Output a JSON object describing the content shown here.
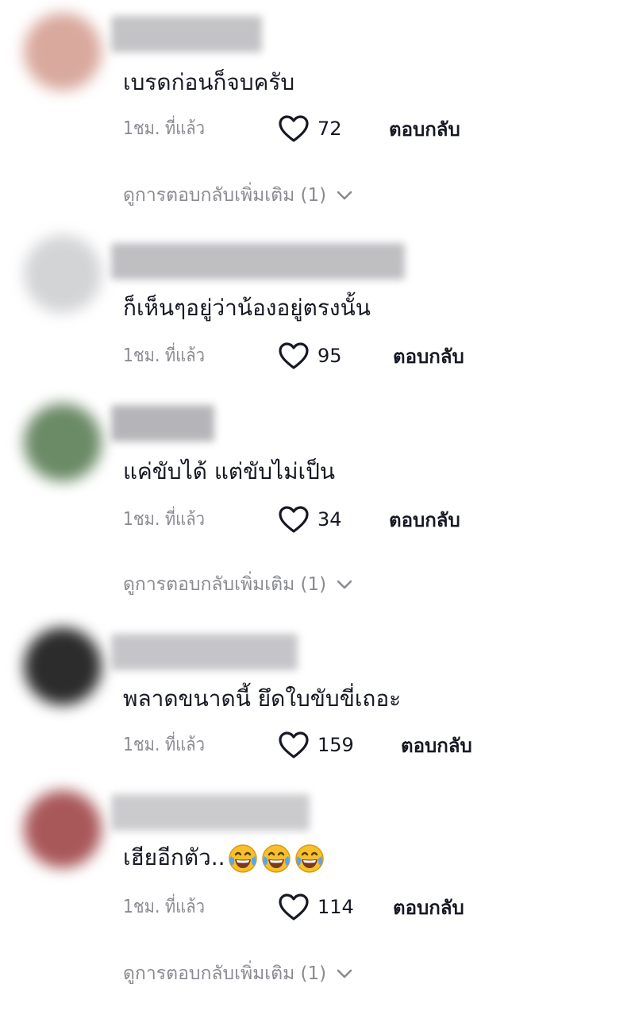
{
  "comments": [
    {
      "text": "เบรดก่อนก็จบครับ",
      "time": "1ชม. ที่แล้ว",
      "likes": "72",
      "reply_label": "ตอบกลับ",
      "view_replies": "ดูการตอบกลับเพิ่มเติม (1)",
      "avatar_color": "#d9a99d",
      "name_blur_color": "#b9b9bd"
    },
    {
      "text": "ก็เห็นๆอยู่ว่าน้องอยู่ตรงนั้น",
      "time": "1ชม. ที่แล้ว",
      "likes": "95",
      "reply_label": "ตอบกลับ",
      "avatar_color": "#d3d4d6",
      "name_blur_color": "#b4b4b8"
    },
    {
      "text": "แค่ขับได้ แต่ขับไม่เป็น",
      "time": "1ชม. ที่แล้ว",
      "likes": "34",
      "reply_label": "ตอบกลับ",
      "view_replies": "ดูการตอบกลับเพิ่มเติม (1)",
      "avatar_color": "#6b8a66",
      "name_blur_color": "#a9a9ad"
    },
    {
      "text": "พลาดขนาดนี้ ยึดใบขับขี่เถอะ",
      "time": "1ชม. ที่แล้ว",
      "likes": "159",
      "reply_label": "ตอบกลับ",
      "avatar_color": "#2c2c2c",
      "name_blur_color": "#bcbcc0"
    },
    {
      "text": "เฮียอีกตัว..",
      "emoji": "face-with-tears-of-joy",
      "emoji_count": 3,
      "time": "1ชม. ที่แล้ว",
      "likes": "114",
      "reply_label": "ตอบกลับ",
      "view_replies": "ดูการตอบกลับเพิ่มเติม (1)",
      "avatar_color": "#a9585a",
      "name_blur_color": "#c2c2c6"
    }
  ]
}
